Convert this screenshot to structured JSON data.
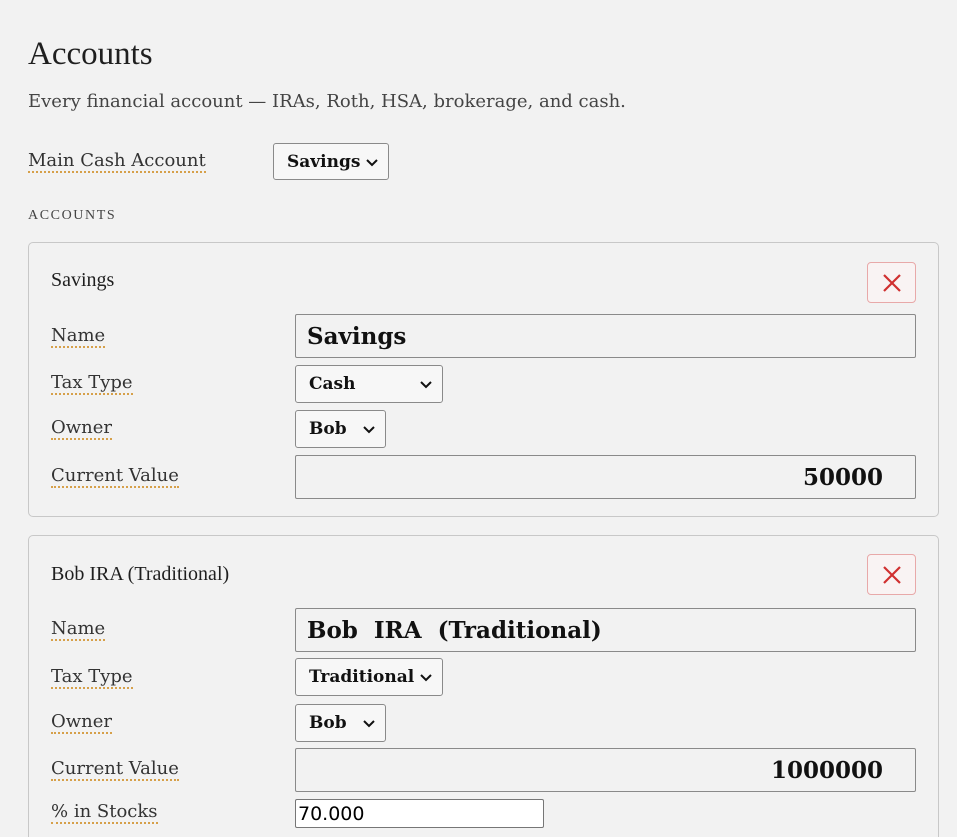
{
  "page": {
    "title": "Accounts",
    "subtitle": "Every financial account — IRAs, Roth, HSA, brokerage, and cash."
  },
  "main_cash": {
    "label": "Main Cash Account",
    "selected": "Savings"
  },
  "accounts_heading": "ACCOUNTS",
  "field_labels": {
    "name": "Name",
    "tax_type": "Tax Type",
    "owner": "Owner",
    "current_value": "Current Value",
    "pct_stocks": "% in Stocks"
  },
  "accounts": [
    {
      "title": "Savings",
      "name": "Savings",
      "tax_type": "Cash",
      "owner": "Bob",
      "current_value": "50000"
    },
    {
      "title": "Bob IRA (Traditional)",
      "name": "Bob  IRA  (Traditional)",
      "tax_type": "Traditional",
      "owner": "Bob",
      "current_value": "1000000",
      "pct_stocks": "70.000"
    }
  ],
  "colors": {
    "background": "#f2f2f2",
    "label_underline": "#d6a04a",
    "delete_icon": "#d03030",
    "delete_border": "#e8a9a9"
  },
  "icons": {
    "delete": "close-icon",
    "dropdown": "chevron-down-icon"
  }
}
